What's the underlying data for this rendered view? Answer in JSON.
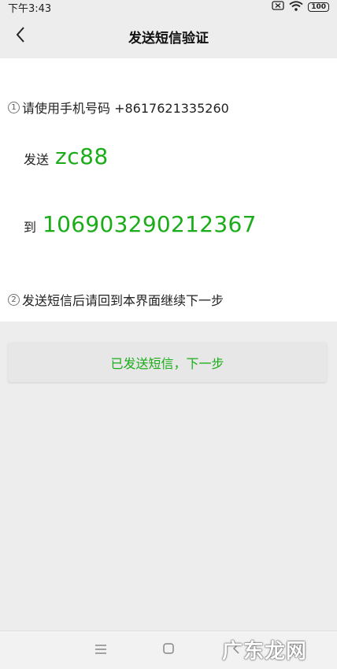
{
  "status_bar": {
    "time": "下午3:43",
    "battery": "100"
  },
  "header": {
    "title": "发送短信验证"
  },
  "steps": {
    "step1_num": "1",
    "step1_text": "请使用手机号码 +8617621335260",
    "send_label": "发送",
    "send_code": "zc88",
    "to_label": "到",
    "to_number": "106903290212367",
    "step2_num": "2",
    "step2_text": "发送短信后请回到本界面继续下一步"
  },
  "actions": {
    "next_label": "已发送短信，下一步"
  },
  "watermark": {
    "text": "广东龙网"
  },
  "colors": {
    "accent": "#1aad19",
    "background": "#ededed",
    "card": "#ffffff"
  }
}
